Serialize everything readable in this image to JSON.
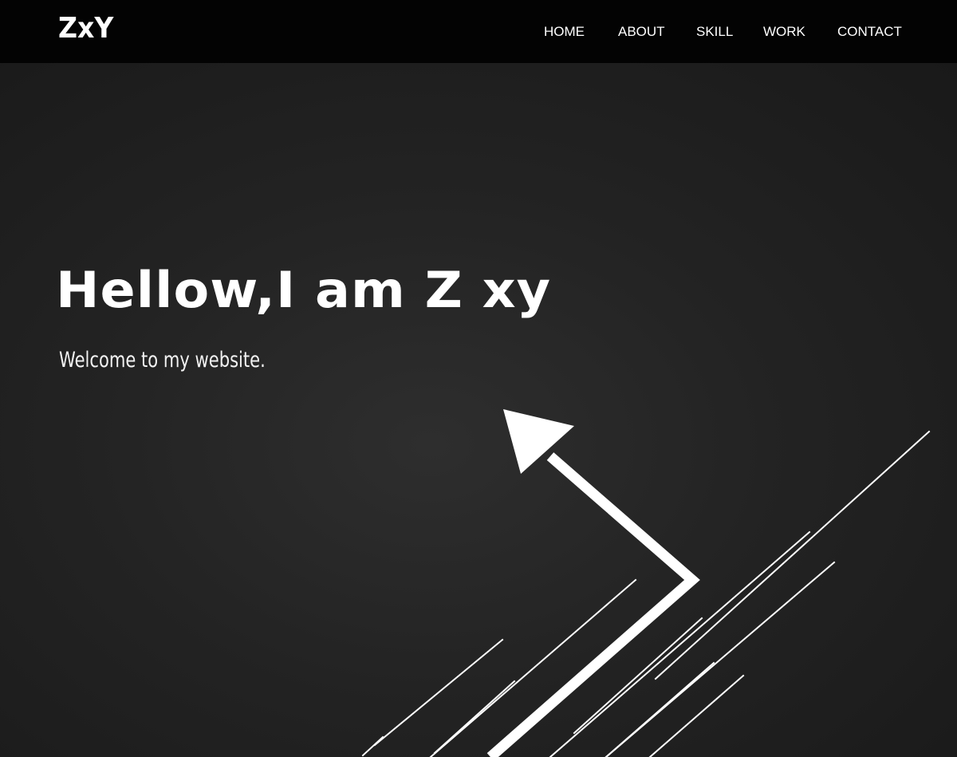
{
  "header": {
    "logo": "ZxY",
    "nav": {
      "home": "HOME",
      "about": "ABOUT",
      "skill": "SKILL",
      "work": "WORK",
      "contact": "CONTACT"
    }
  },
  "hero": {
    "title": "Hellow,I am Z xy",
    "subtitle": "Welcome to my website.",
    "graphic": "arrow-with-speed-lines"
  },
  "colors": {
    "navbar_bg": "#030303",
    "hero_bg": "#232323",
    "text": "#ffffff"
  }
}
